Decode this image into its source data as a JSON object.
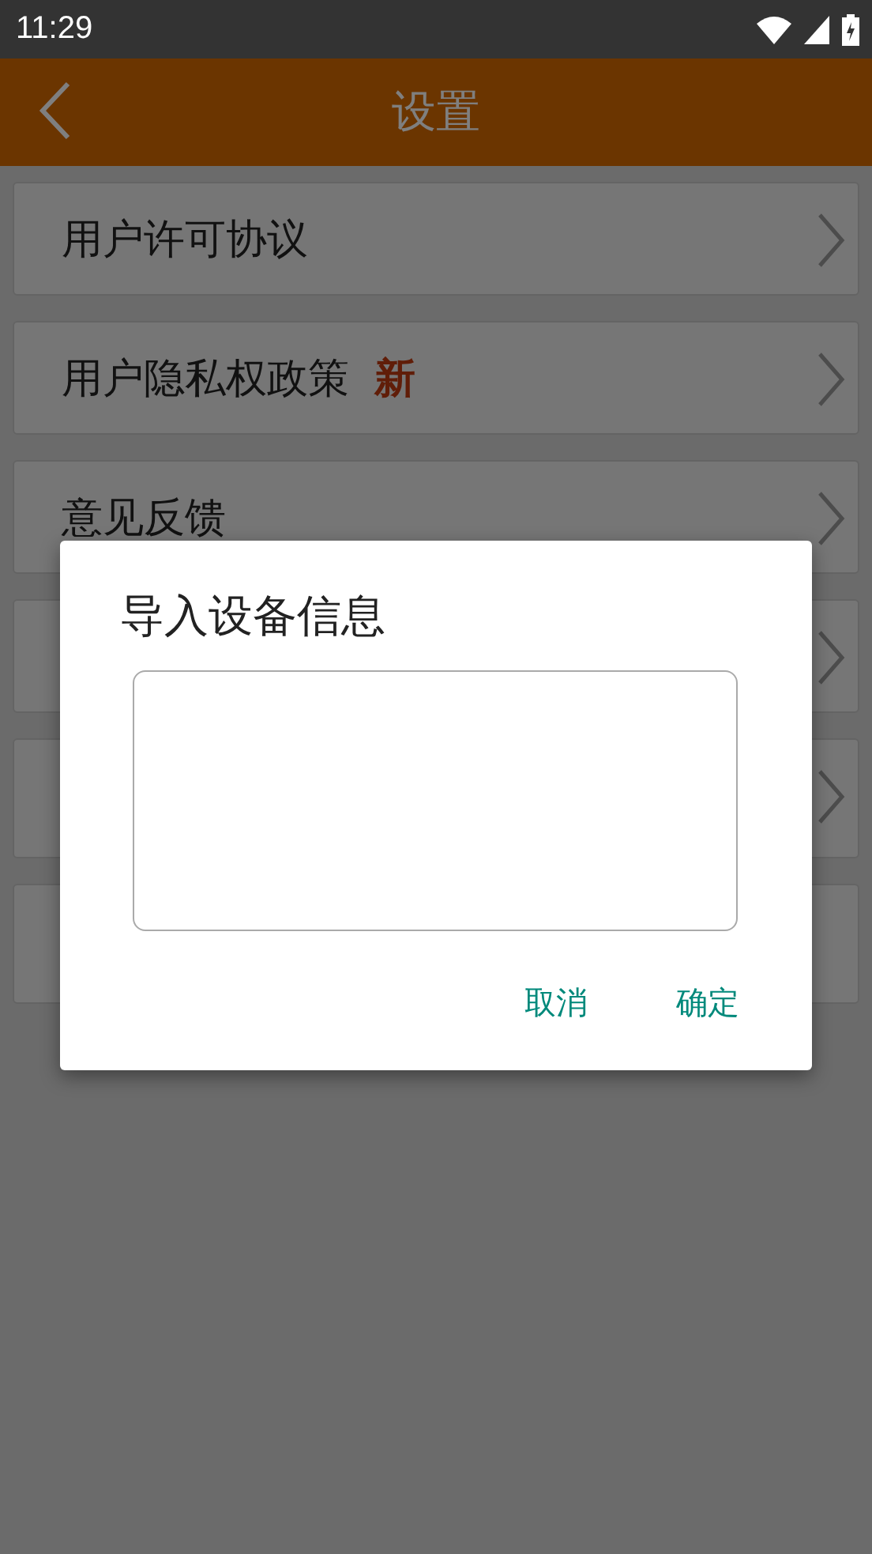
{
  "status_bar": {
    "time": "11:29"
  },
  "header": {
    "title": "设置"
  },
  "rows": [
    {
      "label": "用户许可协议",
      "chevron": true
    },
    {
      "label": "用户隐私权政策",
      "badge": "新",
      "chevron": true
    },
    {
      "label": "意见反馈",
      "chevron": true
    },
    {
      "chevron": true
    },
    {
      "chevron": true
    },
    {
      "chevron": false
    }
  ],
  "dialog": {
    "title": "导入设备信息",
    "buttons": [
      "取消",
      "确定"
    ]
  }
}
